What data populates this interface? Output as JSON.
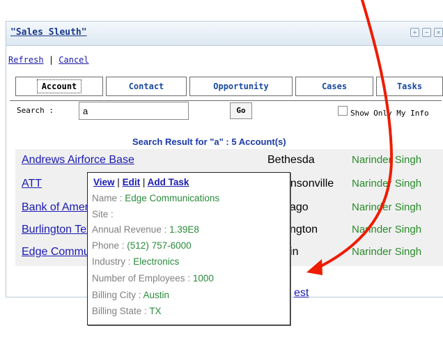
{
  "panel": {
    "title": "\"Sales Sleuth\"",
    "controls": [
      "+",
      "−",
      "×"
    ]
  },
  "links": {
    "refresh": "Refresh",
    "separator": "|",
    "cancel": "Cancel"
  },
  "tabs": [
    {
      "label": "Account",
      "active": true
    },
    {
      "label": "Contact",
      "active": false
    },
    {
      "label": "Opportunity",
      "active": false
    },
    {
      "label": "Cases",
      "active": false
    },
    {
      "label": "Tasks",
      "active": false
    }
  ],
  "search": {
    "label": "Search :",
    "value": "a",
    "go_label": "Go",
    "checkbox_label": "Show Only My Info"
  },
  "result_title": "Search Result for \"a\" : 5 Account(s)",
  "results": [
    {
      "name": "Andrews Airforce Base",
      "city": "Bethesda",
      "owner": "Narinder Singh"
    },
    {
      "name": "ATT",
      "city": "Robinsonville",
      "owner": "Narinder Singh"
    },
    {
      "name": "Bank of America",
      "city": "Chicago",
      "owner": "Narinder Singh"
    },
    {
      "name": "Burlington Textiles",
      "city": "Burlington",
      "owner": "Narinder Singh"
    },
    {
      "name": "Edge Communications",
      "city": "Austin",
      "owner": "Narinder Singh"
    }
  ],
  "more_link": "est",
  "popup": {
    "view": "View",
    "edit": "Edit",
    "add_task": "Add Task",
    "separator": "|",
    "fields": [
      {
        "label": "Name : ",
        "value": "Edge Communications"
      },
      {
        "label": "Site :",
        "value": ""
      },
      {
        "label": "Annual Revenue : ",
        "value": "1.39E8"
      },
      {
        "label": "Phone : ",
        "value": "(512) 757-6000"
      },
      {
        "label": "Industry : ",
        "value": "Electronics"
      },
      {
        "label": "Number of Employees : ",
        "value": "1000"
      },
      {
        "label": "Billing City : ",
        "value": "Austin"
      },
      {
        "label": "Billing State : ",
        "value": "TX"
      }
    ]
  },
  "colors": {
    "arrow": "#ee1c00",
    "link": "#1a1ab0",
    "owner": "#2a8a2a"
  }
}
